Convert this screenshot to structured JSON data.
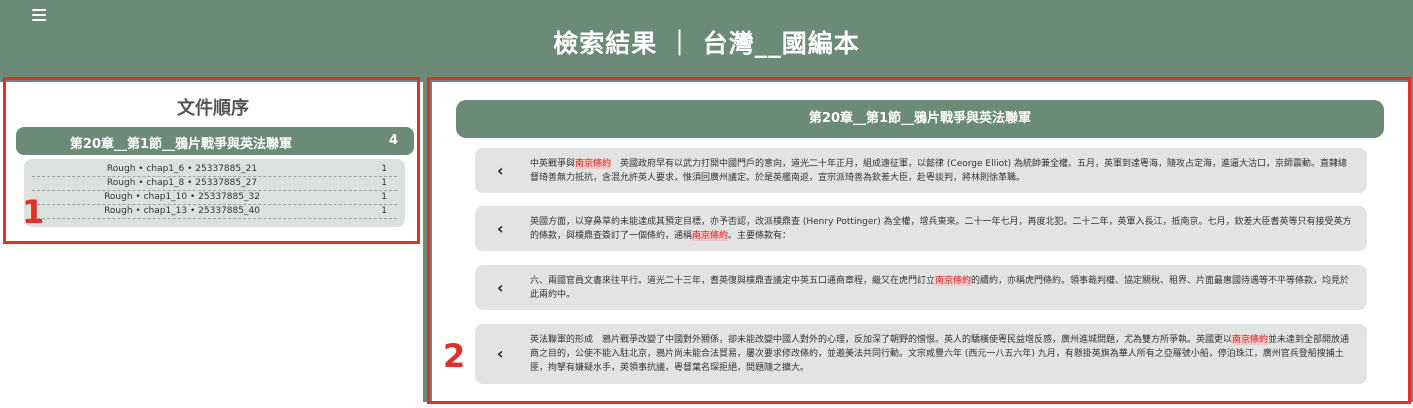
{
  "header": {
    "title": "檢索結果 ｜ 台灣__國編本"
  },
  "left": {
    "title": "文件順序",
    "chapter": {
      "label": "第20章__第1節__鴉片戰爭與英法聯軍",
      "count": "4"
    },
    "items": [
      {
        "name": "Rough • chap1_6 • 25337885_21",
        "count": "1"
      },
      {
        "name": "Rough • chap1_8 • 25337885_27",
        "count": "1"
      },
      {
        "name": "Rough • chap1_10 • 25337885_32",
        "count": "1"
      },
      {
        "name": "Rough • chap1_13 • 25337885_40",
        "count": "1"
      }
    ]
  },
  "right": {
    "title": "第20章__第1節__鴉片戰爭與英法聯軍",
    "arrow": "‹",
    "results": [
      {
        "segments": [
          {
            "text": "中英戰爭與",
            "hl": false
          },
          {
            "text": "南京條約",
            "hl": true
          },
          {
            "text": "　英國政府早有以武力打開中國門戶的意向，道光二十年正月，組成遠征軍，以懿律 (Ceorge Elliot) 為統帥兼全權。五月，英軍到達粵海，隨攻占定海，進逼大沽口，京師震動。直隸總督琦善無力抵抗，含混允許英人要求，惟須回廣州議定。於是英艦南返，宣宗派琦善為欽差大臣，赴粵談判，將林則徐革職。",
            "hl": false
          }
        ]
      },
      {
        "segments": [
          {
            "text": "英國方面，以穿鼻草約未能達成其預定目標，亦予否認，改派樸鼎查 (Henry Pottinger) 為全權，增兵東來。二十一年七月，再度北犯。二十二年，英軍入長江，抵南京。七月，欽差大臣耆英等只有接受英方的條款，與樸鼎查簽訂了一個條約，通稱",
            "hl": false
          },
          {
            "text": "南京條約",
            "hl": true
          },
          {
            "text": "。主要條款有：",
            "hl": false
          }
        ]
      },
      {
        "segments": [
          {
            "text": "六、兩國官員文書來往平行。道光二十三年，耆英復與樸鼎查議定中英五口通商章程，繼又在虎門訂立",
            "hl": false
          },
          {
            "text": "南京條約",
            "hl": true
          },
          {
            "text": "的續約，亦稱虎門條約。領事裁判權、協定關稅、租界、片面最惠國待遇等不平等條款，均見於此兩約中。",
            "hl": false
          }
        ]
      },
      {
        "segments": [
          {
            "text": "英法聯軍的形成　鴉片戰爭改變了中國對外關係，卻未能改變中國人對外的心理，反加深了朝野的憎恨。英人的驕橫使粵民益增反感，廣州進城問題，尤為雙方所爭執。英國更以",
            "hl": false
          },
          {
            "text": "南京條約",
            "hl": true
          },
          {
            "text": "並未達到全部開放通商之目的，公使不能入駐北京，鴉片尚未能合法貿易，屢次要求修改條約，並邀美法共同行動。文宗咸豐六年 (西元一八五六年) 九月，有懸掛英旗為華人所有之亞羅號小船，停泊珠江，廣州官兵登船搜捕土匪，拘拏有嫌疑水手，英領事抗議，粵督葉名琛拒絕，問題隨之擴大。",
            "hl": false
          }
        ]
      }
    ]
  },
  "annotations": {
    "box1": "1",
    "box2": "2"
  },
  "colors": {
    "accent": "#6b8a77",
    "highlight_bg": "#f4c6c6",
    "highlight_text": "#c9302c",
    "annotation": "#e0302a"
  }
}
